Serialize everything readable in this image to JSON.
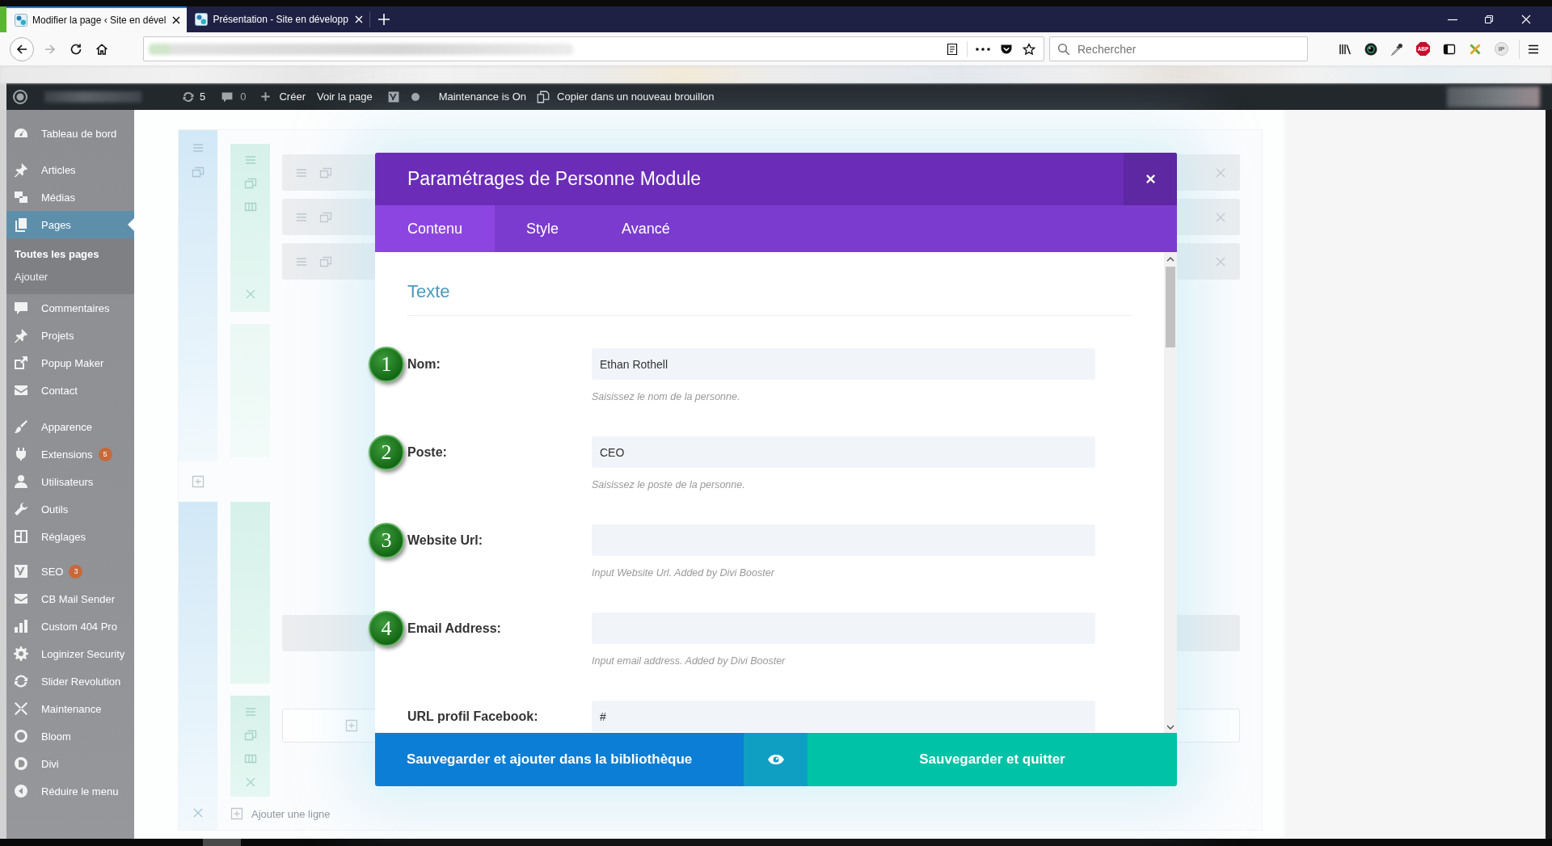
{
  "browser": {
    "tabs": [
      {
        "title": "Modifier la page ‹ Site en dével",
        "selected": true
      },
      {
        "title": "Présentation - Site en développ",
        "selected": false
      }
    ],
    "search": {
      "placeholder": "Rechercher"
    },
    "extension_badges": {
      "adblock": "ABP",
      "ip": "IP"
    }
  },
  "admin_bar": {
    "updates": "5",
    "comments": "0",
    "new_label": "Créer",
    "view_label": "Voir la page",
    "maintenance_label": "Maintenance is On",
    "duplicate_label": "Copier dans un nouveau brouillon"
  },
  "sidebar": {
    "groups": [
      {
        "items": [
          {
            "label": "Tableau de bord",
            "selected": false
          }
        ]
      },
      {
        "items": [
          {
            "label": "Articles",
            "selected": false
          },
          {
            "label": "Médias",
            "selected": false
          },
          {
            "label": "Pages",
            "selected": true,
            "children": [
              {
                "label": "Toutes les pages",
                "selected": true
              },
              {
                "label": "Ajouter",
                "selected": false
              }
            ]
          },
          {
            "label": "Commentaires",
            "selected": false
          },
          {
            "label": "Projets",
            "selected": false
          },
          {
            "label": "Popup Maker",
            "selected": false
          },
          {
            "label": "Contact",
            "selected": false
          }
        ]
      },
      {
        "items": [
          {
            "label": "Apparence",
            "selected": false
          },
          {
            "label": "Extensions",
            "selected": false,
            "badge": "5"
          },
          {
            "label": "Utilisateurs",
            "selected": false
          },
          {
            "label": "Outils",
            "selected": false
          },
          {
            "label": "Réglages",
            "selected": false
          }
        ]
      },
      {
        "items": [
          {
            "label": "SEO",
            "selected": false,
            "badge": "3"
          },
          {
            "label": "CB Mail Sender",
            "selected": false
          },
          {
            "label": "Custom 404 Pro",
            "selected": false
          },
          {
            "label": "Loginizer Security",
            "selected": false
          },
          {
            "label": "Slider Revolution",
            "selected": false
          },
          {
            "label": "Maintenance",
            "selected": false
          },
          {
            "label": "Bloom",
            "selected": false
          },
          {
            "label": "Divi",
            "selected": false
          }
        ]
      }
    ],
    "collapse_label": "Réduire le menu"
  },
  "builder": {
    "add_row_label": "Ajouter une ligne"
  },
  "modal": {
    "title": "Paramétrages de Personne Module",
    "tabs": [
      {
        "label": "Contenu",
        "selected": true
      },
      {
        "label": "Style",
        "selected": false
      },
      {
        "label": "Avancé",
        "selected": false
      }
    ],
    "section_title": "Texte",
    "fields": [
      {
        "label": "Nom:",
        "value": "Ethan Rothell",
        "help": "Saisissez le nom de la personne.",
        "marker": "1"
      },
      {
        "label": "Poste:",
        "value": "CEO",
        "help": "Saisissez le poste de la personne.",
        "marker": "2"
      },
      {
        "label": "Website Url:",
        "help": "Input Website Url. Added by Divi Booster",
        "marker": "3"
      },
      {
        "label": "Email Address:",
        "help": "Input email address. Added by Divi Booster",
        "marker": "4"
      },
      {
        "label": "URL profil Facebook:",
        "value": "#"
      }
    ],
    "save_library_label": "Sauvegarder et ajouter dans la bibliothèque",
    "save_quit_label": "Sauvegarder et quitter"
  }
}
